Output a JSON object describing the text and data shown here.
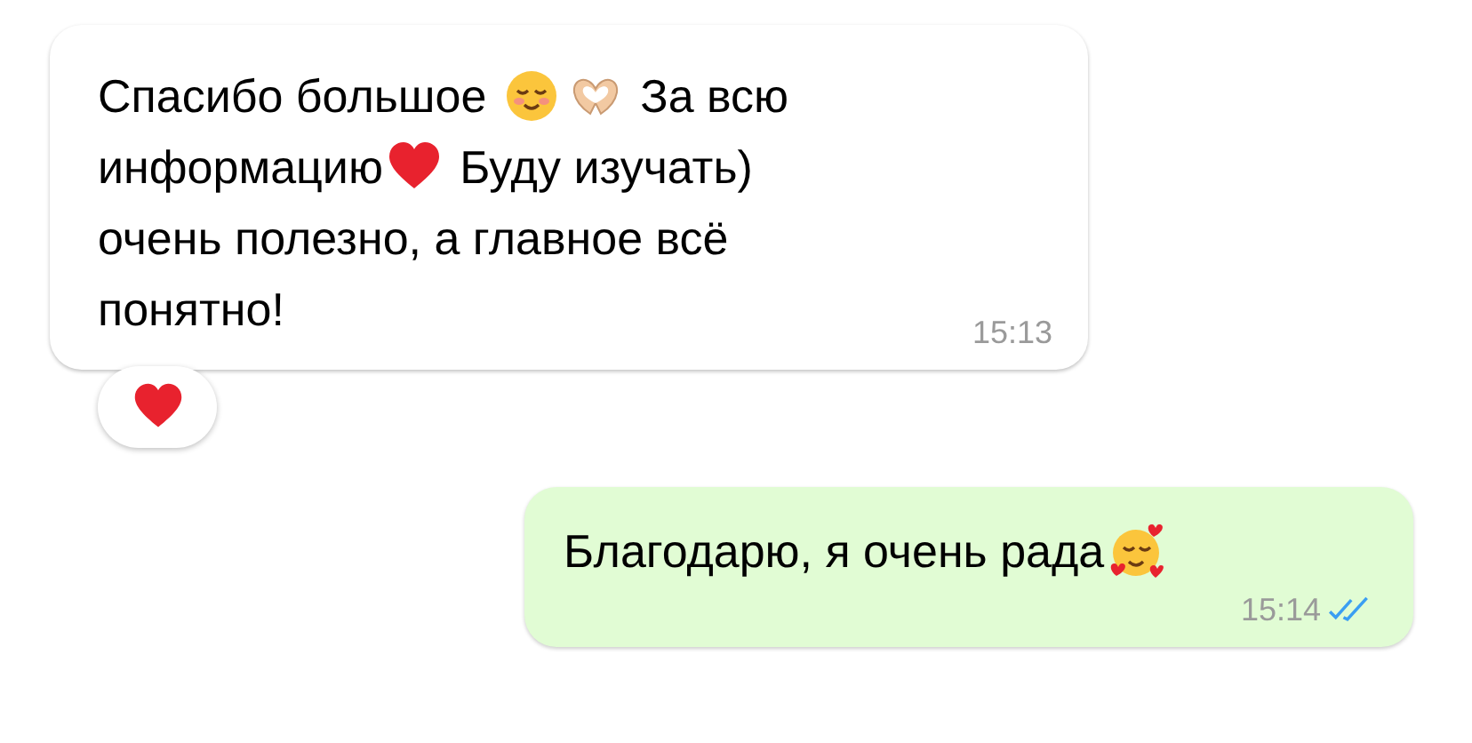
{
  "messages": [
    {
      "kind": "incoming",
      "lines": [
        [
          {
            "kind": "text",
            "text": "Спасибо большое "
          },
          {
            "kind": "smile"
          },
          {
            "kind": "hands"
          },
          {
            "kind": "text",
            "text": " За всю"
          }
        ],
        [
          {
            "kind": "text",
            "text": "информацию"
          },
          {
            "kind": "heart"
          },
          {
            "kind": "text",
            "text": " Буду изучать)"
          }
        ],
        [
          {
            "kind": "text",
            "text": "очень полезно, а главное всё"
          }
        ],
        [
          {
            "kind": "text",
            "text": "понятно!"
          }
        ]
      ],
      "time": "15:13",
      "reaction": {
        "kind": "heart"
      }
    },
    {
      "kind": "outgoing",
      "lines": [
        [
          {
            "kind": "text",
            "text": "Благодарю, я очень рада"
          },
          {
            "kind": "blush"
          }
        ]
      ],
      "time": "15:14",
      "read": true
    }
  ]
}
